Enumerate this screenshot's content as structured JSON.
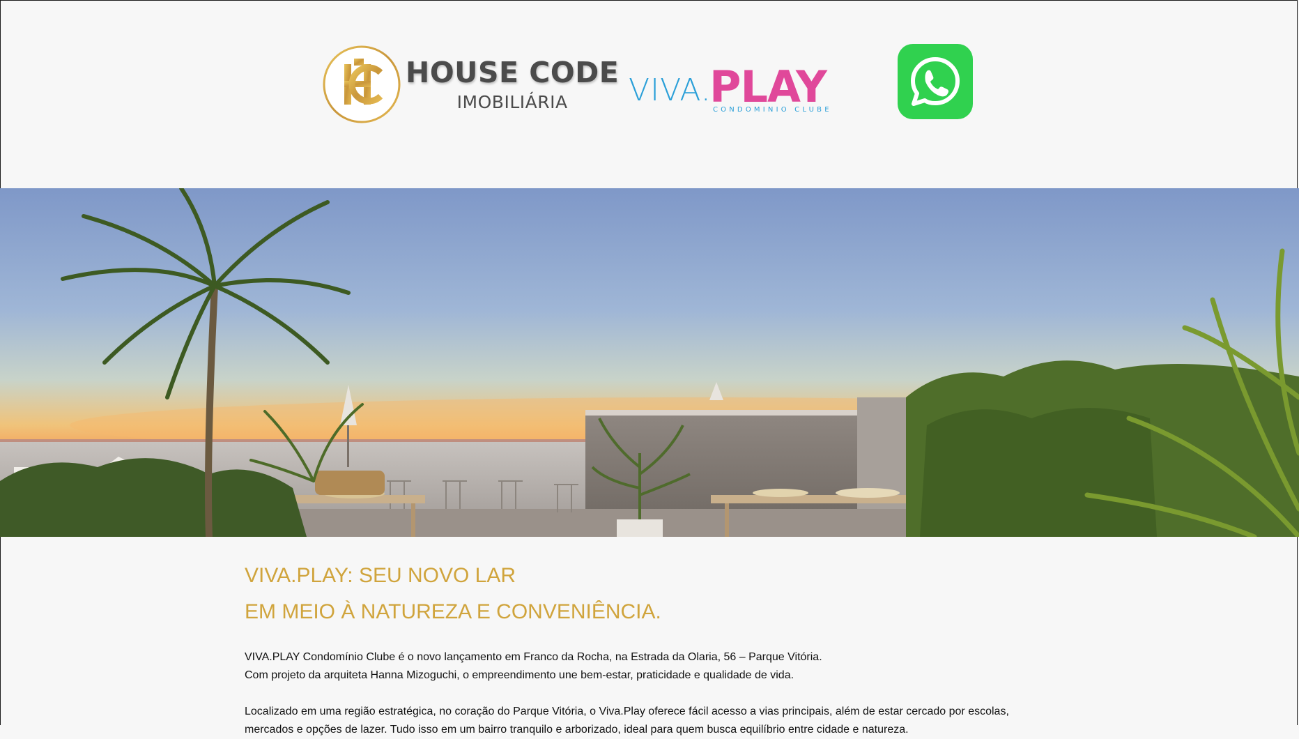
{
  "header": {
    "house_code": {
      "title": "HOUSE CODE",
      "subtitle": "IMOBILIÁRIA",
      "emblem_letters": "HC",
      "icon": "house-code-emblem"
    },
    "viva_play": {
      "viva": "VIVA.",
      "play": "PLAY",
      "subtitle": "CONDOMINIO CLUBE"
    },
    "whatsapp": {
      "icon": "whatsapp-icon",
      "color": "#30d14f"
    }
  },
  "hero": {
    "image": "rooftop-terrace-palms-sunset"
  },
  "main": {
    "headline_line1": "VIVA.PLAY: SEU NOVO LAR",
    "headline_line2": "EM MEIO À NATUREZA E CONVENIÊNCIA.",
    "paragraph1_line1": "VIVA.PLAY Condomínio Clube é o novo lançamento em Franco da Rocha, na Estrada da Olaria, 56 – Parque Vitória.",
    "paragraph1_line2": "Com projeto da arquiteta Hanna Mizoguchi, o empreendimento une bem-estar, praticidade e qualidade de vida.",
    "paragraph2_line1": "Localizado em uma região estratégica, no coração do Parque Vitória, o Viva.Play oferece fácil acesso a vias principais, além de estar cercado por escolas,",
    "paragraph2_line2": "mercados e opções de lazer. Tudo isso em um bairro tranquilo e arborizado, ideal para quem busca equilíbrio entre cidade e natureza."
  },
  "colors": {
    "gold": "#d0a43c",
    "pink": "#e0489a",
    "blue": "#2a9fd8",
    "whatsapp_green": "#30d14f"
  }
}
